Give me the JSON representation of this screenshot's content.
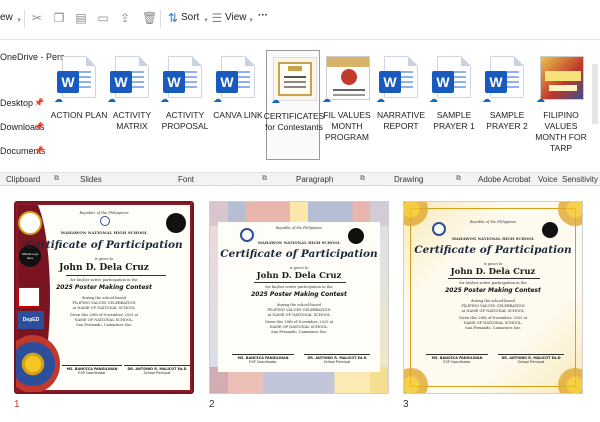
{
  "topbar": {
    "view_prefix": "ew",
    "sort_label": "Sort",
    "view_label": "View",
    "more_label": "···"
  },
  "nav": {
    "items": [
      {
        "label": "OneDrive - Pers"
      },
      {
        "label": "Desktop"
      },
      {
        "label": "Downloads"
      },
      {
        "label": "Documents"
      }
    ]
  },
  "files": [
    {
      "name": "ACTION PLAN",
      "type": "word"
    },
    {
      "name": "ACTIVITY MATRIX",
      "type": "word"
    },
    {
      "name": "ACTIVITY PROPOSAL",
      "type": "word"
    },
    {
      "name": "CANVA LINK",
      "type": "word"
    },
    {
      "name": "CERTIFICATES for Contestants",
      "type": "image",
      "selected": true
    },
    {
      "name": "FIL VALUES MONTH PROGRAM",
      "type": "image"
    },
    {
      "name": "NARRATIVE REPORT",
      "type": "word"
    },
    {
      "name": "SAMPLE PRAYER 1",
      "type": "word"
    },
    {
      "name": "SAMPLE PRAYER 2",
      "type": "word"
    },
    {
      "name": "FILIPINO VALUES MONTH FOR TARP",
      "type": "image"
    }
  ],
  "ribbon": {
    "groups": [
      "Clipboard",
      "Slides",
      "Font",
      "Paragraph",
      "Drawing",
      "Adobe Acrobat",
      "Voice",
      "Sensitivity"
    ]
  },
  "certificate": {
    "republic": "Republic of the Philippines",
    "school": "MAHAWON NATIONAL HIGH SCHOOL",
    "title": "Certificate of Participation",
    "given_to": "is given to",
    "name": "John D. Dela Cruz",
    "for_text": "for his/her active participation in the",
    "contest": "2025 Poster Making Contest",
    "during": "during the school-based",
    "celebration": "FILIPINO VALUES CELEBRATION",
    "at": "at NAME OF NATIONAL SCHOOL",
    "given_this": "Given this 28th of November, 2025 at",
    "place1": "NAME OF NATIONAL SCHOOL,",
    "place2": "San Fernando, Camarines Sur.",
    "sig1_name": "MS. BANCECA PANGILINAN",
    "sig1_role": "ESP Coordinator",
    "sig2_name": "DR. ANTONIO R. MALICOT Ed.D",
    "sig2_role": "School Principal",
    "badge": "DepED",
    "seal_text": "Official Logo Here"
  },
  "slides": [
    {
      "number": "1",
      "active": true
    },
    {
      "number": "2",
      "active": false
    },
    {
      "number": "3",
      "active": false
    }
  ]
}
